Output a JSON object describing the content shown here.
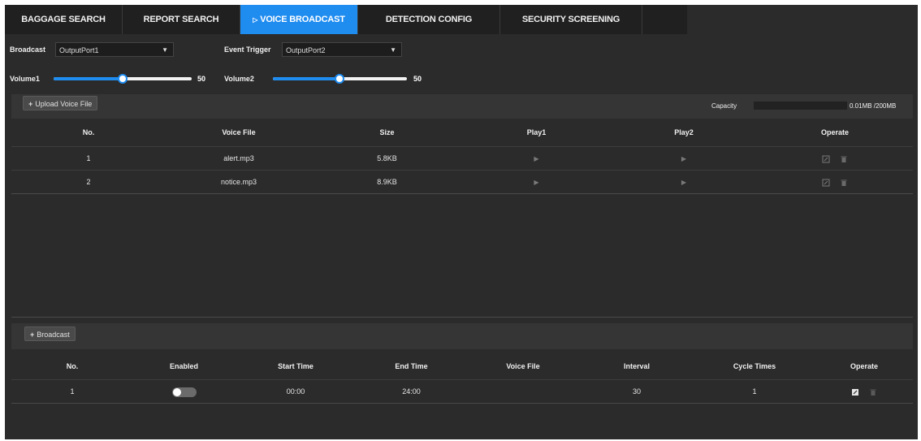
{
  "tabs": [
    {
      "label": "BAGGAGE SEARCH",
      "active": false
    },
    {
      "label": "REPORT SEARCH",
      "active": false
    },
    {
      "label": "VOICE BROADCAST",
      "active": true
    },
    {
      "label": "DETECTION CONFIG",
      "active": false
    },
    {
      "label": "SECURITY SCREENING",
      "active": false
    }
  ],
  "controls": {
    "broadcast_label": "Broadcast",
    "broadcast_value": "OutputPort1",
    "event_trigger_label": "Event Trigger",
    "event_trigger_value": "OutputPort2",
    "volume1_label": "Volume1",
    "volume1_value": "50",
    "volume2_label": "Volume2",
    "volume2_value": "50"
  },
  "voice_files": {
    "upload_label": "Upload Voice File",
    "capacity_label": "Capacity",
    "capacity_value": "0.01MB /200MB",
    "columns": [
      "No.",
      "Voice File",
      "Size",
      "Play1",
      "Play2",
      "Operate"
    ],
    "rows": [
      {
        "no": "1",
        "file": "alert.mp3",
        "size": "5.8KB"
      },
      {
        "no": "2",
        "file": "notice.mp3",
        "size": "8.9KB"
      }
    ]
  },
  "broadcast": {
    "add_label": "Broadcast",
    "columns": [
      "No.",
      "Enabled",
      "Start Time",
      "End Time",
      "Voice File",
      "Interval",
      "Cycle Times",
      "Operate"
    ],
    "rows": [
      {
        "no": "1",
        "enabled": false,
        "start": "00:00",
        "end": "24:00",
        "voice_file": "",
        "interval": "30",
        "cycle": "1"
      }
    ]
  },
  "colors": {
    "accent": "#1f8cf0",
    "background": "#2b2b2b"
  }
}
